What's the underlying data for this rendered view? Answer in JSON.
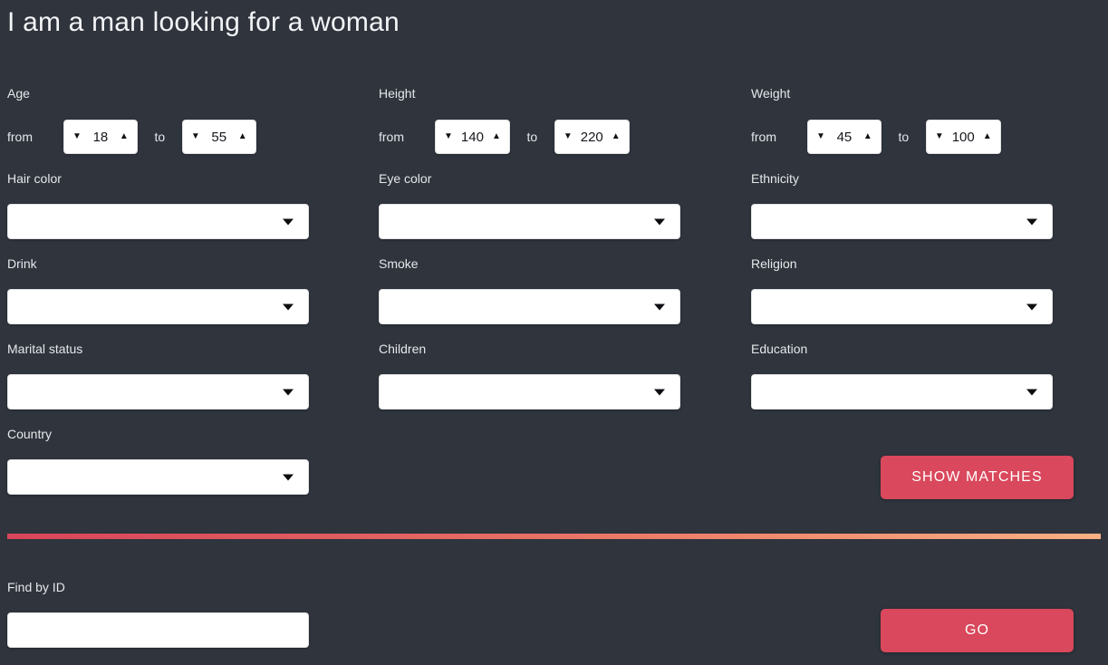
{
  "page": {
    "title": "I am a man looking for a woman",
    "background_color": "#2f343d",
    "accent_color": "#d9485c",
    "divider_gradient_from": "#d9455a",
    "divider_gradient_to": "#f8b184"
  },
  "ranges": [
    {
      "label": "Age",
      "from_word": "from",
      "to_word": "to",
      "from_value": "18",
      "to_value": "55",
      "down_arrow": "▼",
      "up_arrow": "▲"
    },
    {
      "label": "Height",
      "from_word": "from",
      "to_word": "to",
      "from_value": "140",
      "to_value": "220",
      "down_arrow": "▼",
      "up_arrow": "▲"
    },
    {
      "label": "Weight",
      "from_word": "from",
      "to_word": "to",
      "from_value": "45",
      "to_value": "100",
      "down_arrow": "▼",
      "up_arrow": "▲"
    }
  ],
  "selects": [
    {
      "label": "Hair color",
      "value": ""
    },
    {
      "label": "Eye color",
      "value": ""
    },
    {
      "label": "Ethnicity",
      "value": ""
    },
    {
      "label": "Drink",
      "value": ""
    },
    {
      "label": "Smoke",
      "value": ""
    },
    {
      "label": "Religion",
      "value": ""
    },
    {
      "label": "Marital status",
      "value": ""
    },
    {
      "label": "Children",
      "value": ""
    },
    {
      "label": "Education",
      "value": ""
    },
    {
      "label": "Country",
      "value": ""
    }
  ],
  "show_matches_button": {
    "label": "SHOW MATCHES"
  },
  "find_by_id": {
    "label": "Find by ID",
    "value": "",
    "placeholder": "",
    "button_label": "GO"
  }
}
